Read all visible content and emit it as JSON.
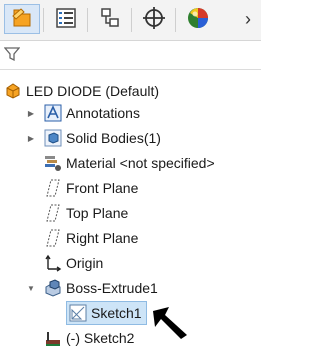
{
  "toolbar": {
    "buttons": [
      {
        "icon": "feature-manager-icon",
        "active": true
      },
      {
        "icon": "property-manager-icon",
        "active": false
      },
      {
        "icon": "configuration-manager-icon",
        "active": false
      },
      {
        "icon": "dimxpert-manager-icon",
        "active": false
      },
      {
        "icon": "display-manager-icon",
        "active": false
      }
    ],
    "more_label": "›"
  },
  "filter": {
    "icon": "filter-icon"
  },
  "tree": {
    "root": {
      "label": "LED DIODE  (Default)",
      "icon": "part-icon"
    },
    "items": [
      {
        "label": "Annotations",
        "icon": "annotations-icon",
        "expander": "collapsed"
      },
      {
        "label": "Solid Bodies(1)",
        "icon": "solid-bodies-icon",
        "expander": "collapsed"
      },
      {
        "label": "Material <not specified>",
        "icon": "material-icon",
        "expander": "none"
      },
      {
        "label": "Front Plane",
        "icon": "plane-icon",
        "expander": "none"
      },
      {
        "label": "Top Plane",
        "icon": "plane-icon",
        "expander": "none"
      },
      {
        "label": "Right Plane",
        "icon": "plane-icon",
        "expander": "none"
      },
      {
        "label": "Origin",
        "icon": "origin-icon",
        "expander": "none"
      },
      {
        "label": "Boss-Extrude1",
        "icon": "boss-extrude-icon",
        "expander": "expanded"
      },
      {
        "label": "Sketch1",
        "icon": "sketch-icon",
        "expander": "none",
        "selected": true
      },
      {
        "label": "(-) Sketch2",
        "icon": "sketch-icon",
        "expander": "none"
      }
    ]
  },
  "colors": {
    "selection": "#cde4f7",
    "selection_border": "#8fbbe3",
    "toolbar_bg": "#f3f3f3"
  }
}
